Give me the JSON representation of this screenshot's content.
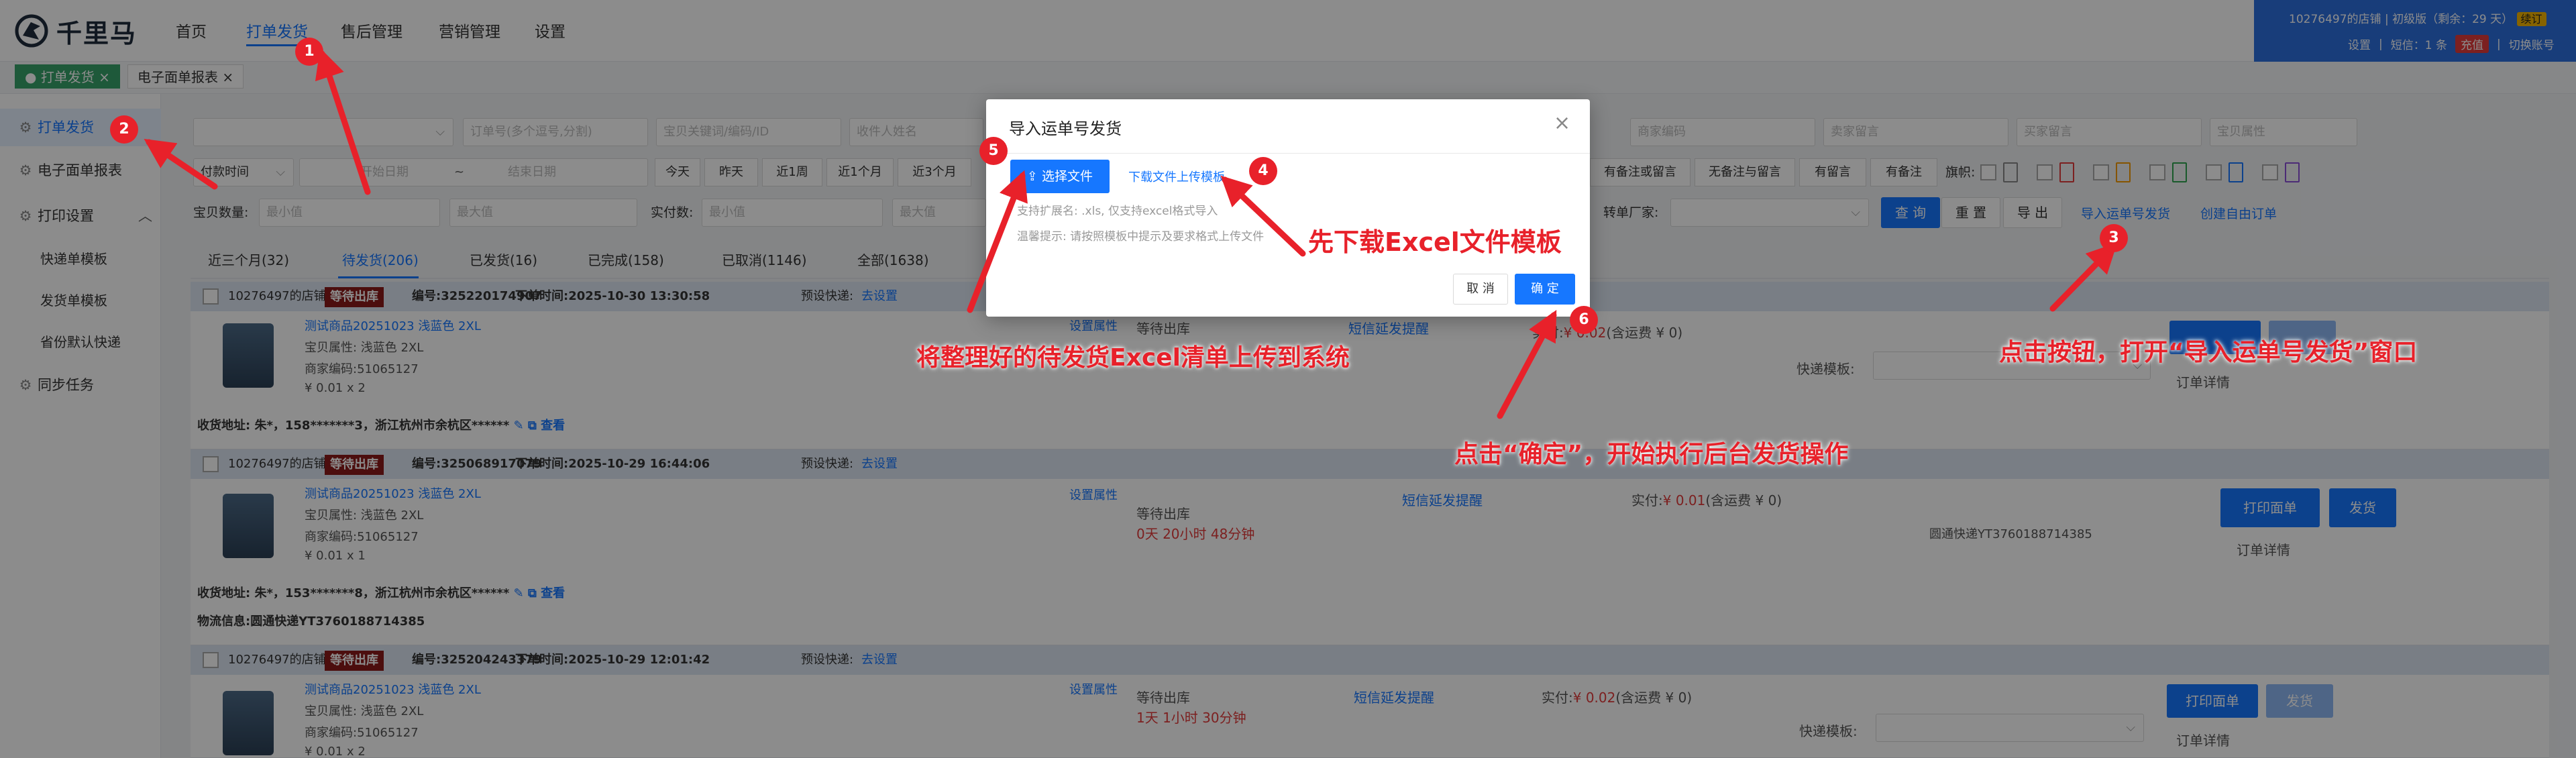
{
  "app": {
    "logo_text": "千里马"
  },
  "nav": {
    "items": [
      "首页",
      "打单发货",
      "售后管理",
      "营销管理",
      "设置"
    ]
  },
  "user": {
    "shop": "10276497的店铺",
    "version": "初级版（剩余：29 天）",
    "renew": "续订",
    "settings": "设置",
    "sms": "短信：1 条",
    "recharge": "充值",
    "switch": "切换账号"
  },
  "tabs": [
    {
      "label": "打单发货"
    },
    {
      "label": "电子面单报表"
    }
  ],
  "sidebar": {
    "items": [
      "打单发货",
      "电子面单报表",
      "打印设置",
      "同步任务"
    ],
    "subitems": [
      "快递单模板",
      "发货单模板",
      "省份默认快递"
    ]
  },
  "filters": {
    "order_no": "订单号(多个逗号,分割)",
    "keyword": "宝贝关键词/编码/ID",
    "receiver": "收件人姓名",
    "merchant_code": "商家编码",
    "seller_msg": "卖家留言",
    "buyer_msg": "买家留言",
    "item_attr": "宝贝属性",
    "time_type": "付款时间",
    "start_date": "开始日期",
    "tilde": "~",
    "end_date": "结束日期",
    "quick": [
      "今天",
      "昨天",
      "近1周",
      "近1个月",
      "近3个月"
    ],
    "msg_filters": [
      "有备注或留言",
      "无备注与留言",
      "有留言",
      "有备注"
    ],
    "flag_label": "旗帜:",
    "qty_label": "宝贝数量:",
    "min": "最小值",
    "max": "最大值",
    "paid_label": "实付数:",
    "factory_label": "转单厂家:",
    "query": "查 询",
    "reset": "重 置",
    "export": "导 出",
    "import_link": "导入运单号发货",
    "create_link": "创建自由订单"
  },
  "status_tabs": [
    "近三个月(32)",
    "待发货(206)",
    "已发货(16)",
    "已完成(158)",
    "已取消(1146)",
    "全部(1638)"
  ],
  "orders": [
    {
      "shop": "10276497的店铺",
      "status": "等待出库",
      "no": "编号:325220174907",
      "time": "下单时间:2025-10-30 13:30:58",
      "express_label": "预设快递:",
      "express": "去设置",
      "product": "测试商品20251023 浅蓝色 2XL",
      "attr": "宝贝属性: 浅蓝色 2XL",
      "code": "商家编码:51065127",
      "price": "¥ 0.01 x 2",
      "set_prop": "设置属性",
      "wait": "等待出库",
      "sms": "短信延发提醒",
      "paid_label": "实付:",
      "paid": "¥ 0.02",
      "paid_note": "(含运费 ¥ 0)",
      "tpl_label": "快递模板:",
      "detail": "订单详情",
      "addr": "收货地址: 朱*，158*******3，浙江杭州市余杭区******",
      "view": "查看"
    },
    {
      "shop": "10276497的店铺",
      "status": "等待出库",
      "no": "编号:325068917079",
      "time": "下单时间:2025-10-29 16:44:06",
      "express_label": "预设快递:",
      "express": "去设置",
      "product": "测试商品20251023 浅蓝色 2XL",
      "attr": "宝贝属性: 浅蓝色 2XL",
      "code": "商家编码:51065127",
      "price": "¥ 0.01 x 1",
      "set_prop": "设置属性",
      "wait": "等待出库",
      "countdown": "0天 20小时 48分钟",
      "sms": "短信延发提醒",
      "paid_label": "实付:",
      "paid": "¥ 0.01",
      "paid_note": "(含运费 ¥ 0)",
      "print": "打印面单",
      "ship": "发货",
      "tracking": "圆通快递YT3760188714385",
      "detail": "订单详情",
      "addr": "收货地址: 朱*，153*******8，浙江杭州市余杭区******",
      "view": "查看",
      "logistics": "物流信息:圆通快递YT3760188714385"
    },
    {
      "shop": "10276497的店铺",
      "status": "等待出库",
      "no": "编号:325204243379",
      "time": "下单时间:2025-10-29 12:01:42",
      "express_label": "预设快递:",
      "express": "去设置",
      "product": "测试商品20251023 浅蓝色 2XL",
      "attr": "宝贝属性: 浅蓝色 2XL",
      "code": "商家编码:51065127",
      "price": "¥ 0.01 x 2",
      "set_prop": "设置属性",
      "wait": "等待出库",
      "countdown": "1天 1小时 30分钟",
      "sms": "短信延发提醒",
      "paid_label": "实付:",
      "paid": "¥ 0.02",
      "paid_note": "(含运费 ¥ 0)",
      "print": "打印面单",
      "ship": "发货",
      "tpl_label": "快递模板:",
      "detail": "订单详情"
    }
  ],
  "modal": {
    "title": "导入运单号发货",
    "select_file": "选择文件",
    "download": "下载文件上传模板",
    "hint1": "支持扩展名: .xls, 仅支持excel格式导入",
    "hint2": "温馨提示: 请按照模板中提示及要求格式上传文件",
    "cancel": "取 消",
    "ok": "确 定"
  },
  "annotations": {
    "markers": [
      "1",
      "2",
      "3",
      "4",
      "5",
      "6"
    ],
    "t_download": "先下载Excel文件模板",
    "t_upload": "将整理好的待发货Excel清单上传到系统",
    "t_open": "点击按钮，打开“导入运单号发货”窗口",
    "t_confirm": "点击“确定”，开始执行后台发货操作"
  },
  "colors": {
    "primary": "#1677ff",
    "annotation": "#e8212a",
    "pending": "#8b1a1a",
    "user_bar": "#2d6fdf"
  }
}
